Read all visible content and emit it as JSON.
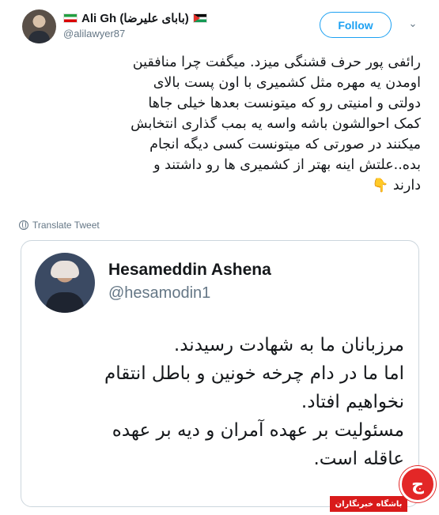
{
  "author": {
    "display_name": "Ali Gh (بابای علیرضا)",
    "handle": "@alilawyer87",
    "follow_label": "Follow"
  },
  "tweet": {
    "lines": [
      "رائفی پور حرف قشنگی میزد. میگفت چرا منافقین",
      "اومدن یه مهره مثل کشمیری با اون پست بالای",
      "دولتی و امنیتی رو که میتونست بعدها خیلی جاها",
      "کمک احوالشون باشه واسه یه بمب گذاری انتخابش",
      "میکنند در صورتی که میتونست کسی دیگه انجام",
      "بده..علتش اینه بهتر از کشمیری ها رو داشتند و",
      "دارند"
    ],
    "emoji": "👇",
    "translate_label": "Translate Tweet"
  },
  "quoted": {
    "display_name": "Hesameddin Ashena",
    "handle": "@hesamodin1",
    "lines": [
      "مرزبانان ما به شهادت رسیدند.",
      "اما ما در دام چرخه خونین و باطل انتقام",
      "نخواهیم افتاد.",
      "مسئولیت بر عهده آمران و دیه بر عهده",
      "عاقله است."
    ]
  },
  "watermark": {
    "label": "باشگاه خبرنگاران",
    "logo_glyph": "ج",
    "color": "#e32727"
  },
  "colors": {
    "accent": "#1da1f2",
    "muted": "#657786",
    "border": "#ccd6dd"
  },
  "icons": {
    "caret": "chevron-down-icon",
    "translate": "globe-icon"
  }
}
